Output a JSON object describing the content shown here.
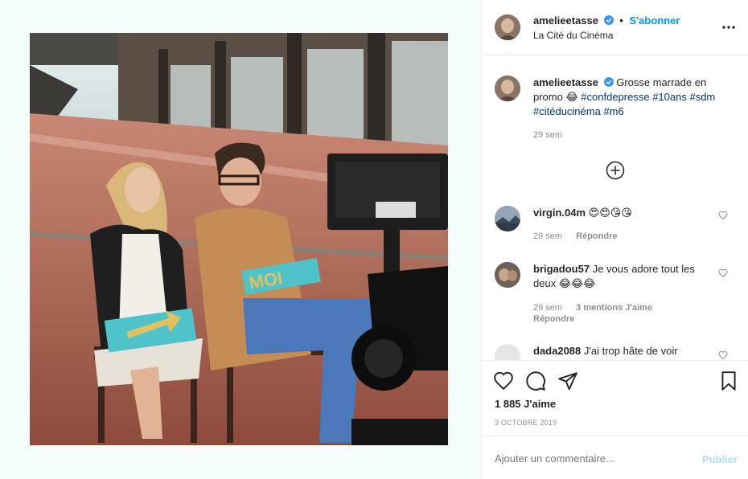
{
  "post": {
    "username": "amelieetasse",
    "follow_label": "S'abonner",
    "separator": "•",
    "location": "La Cité du Cinéma"
  },
  "caption": {
    "username": "amelieetasse",
    "text_main": "Grosse marrade en promo 😂",
    "tags": [
      "#confdepresse",
      "#10ans",
      "#sdm",
      "#citéducinéma",
      "#m6"
    ],
    "time": "29 sem"
  },
  "comments": [
    {
      "username": "virgin.04m",
      "text": "😍😍😘😘",
      "time": "29 sem",
      "reply": "Répondre",
      "likes": ""
    },
    {
      "username": "brigadou57",
      "text": "Je vous adore tout les deux 😂😂😂",
      "time": "29 sem",
      "likes": "3 mentions J'aime",
      "reply": "Répondre"
    },
    {
      "username": "dada2088",
      "text": "J'ai trop hâte de voir"
    }
  ],
  "likes_count": "1 885 J'aime",
  "date": "3 OCTOBRE 2019",
  "add_comment": {
    "placeholder": "Ajouter un commentaire...",
    "publish": "Publier"
  },
  "photo_sign": "MOI",
  "icons": [
    "verified-icon",
    "more-icon",
    "plus-circle-icon",
    "heart-icon",
    "comment-icon",
    "share-icon",
    "bookmark-icon"
  ],
  "colors": {
    "accent": "#0095f6",
    "tag": "#00376b",
    "muted": "#8e8e8e",
    "publish_disabled": "#b2dffc"
  }
}
